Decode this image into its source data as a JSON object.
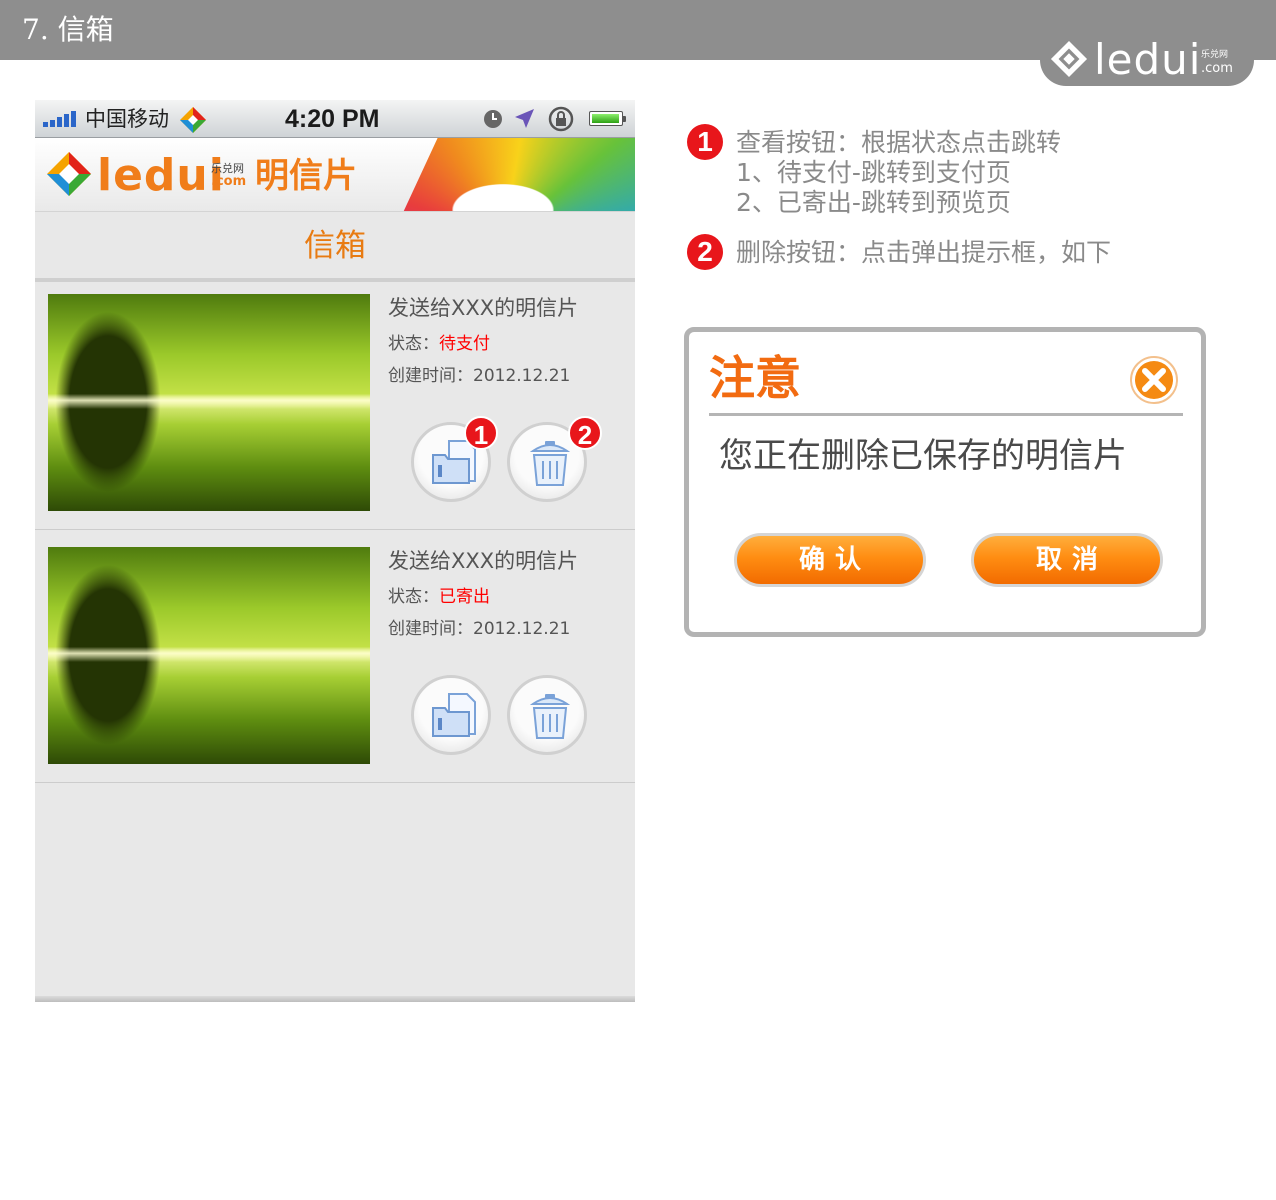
{
  "slide": {
    "title": "7. 信箱",
    "brand": {
      "name": "ledui",
      "sub": "乐兑网",
      "com": ".com"
    }
  },
  "status_bar": {
    "carrier": "中国移动",
    "time": "4:20 PM",
    "icons": [
      "signal-icon",
      "carrier-logo-icon",
      "alarm-clock-icon",
      "location-arrow-icon",
      "rotation-lock-icon",
      "battery-icon"
    ]
  },
  "banner": {
    "brand": "ledui",
    "sub": "乐兑网",
    "com": ".com",
    "product": "明信片"
  },
  "page": {
    "title": "信箱"
  },
  "mailbox": {
    "items": [
      {
        "title": "发送给XXX的明信片",
        "status_label": "状态：",
        "status_value": "待支付",
        "date_label": "创建时间：",
        "date_value": "2012.12.21",
        "markers": [
          "1",
          "2"
        ]
      },
      {
        "title": "发送给XXX的明信片",
        "status_label": "状态：",
        "status_value": "已寄出",
        "date_label": "创建时间：",
        "date_value": "2012.12.21",
        "markers": []
      }
    ]
  },
  "annotations": [
    {
      "marker": "1",
      "lines": [
        "查看按钮：根据状态点击跳转",
        "1、待支付-跳转到支付页",
        "2、已寄出-跳转到预览页"
      ]
    },
    {
      "marker": "2",
      "lines": [
        "删除按钮：点击弹出提示框，如下"
      ]
    }
  ],
  "dialog": {
    "title": "注意",
    "message": "您正在删除已保存的明信片",
    "confirm_label": "确认",
    "cancel_label": "取消"
  },
  "colors": {
    "accent_orange": "#f07d1a",
    "status_red": "#ff0000",
    "marker_red": "#e8161b",
    "header_gray": "#8e8e8e"
  }
}
